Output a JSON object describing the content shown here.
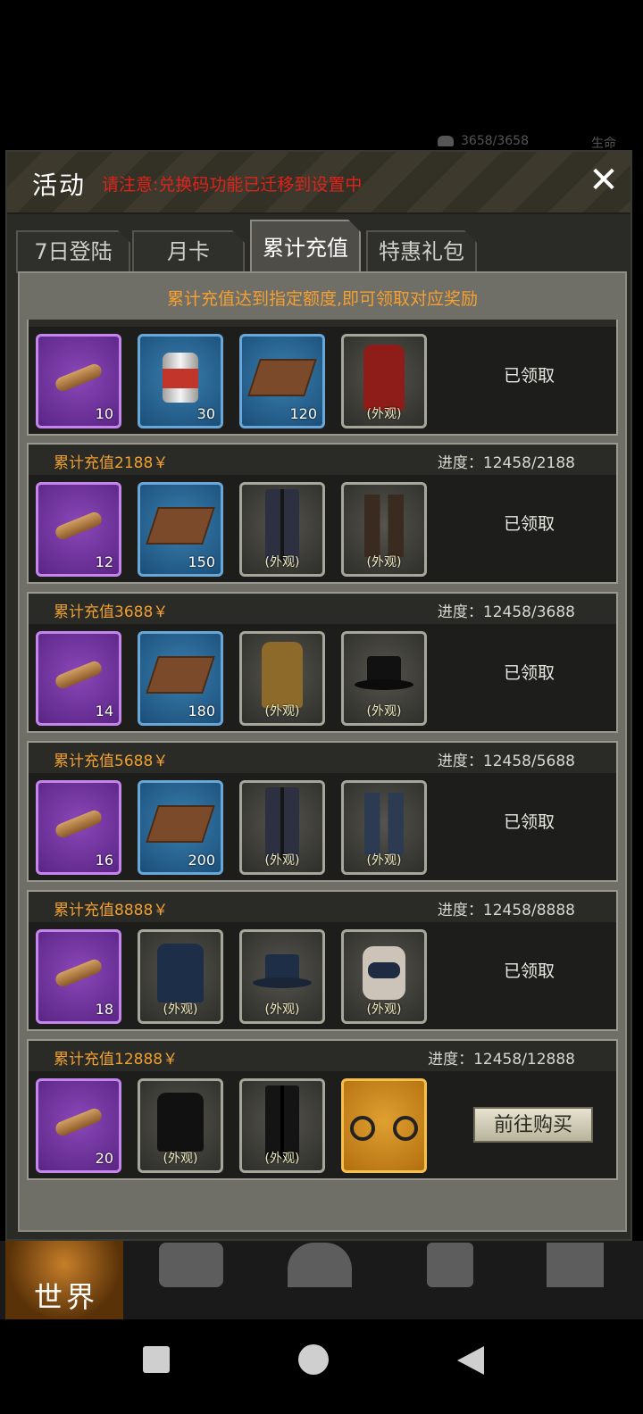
{
  "status": {
    "hp_text": "3658/3658",
    "life_label": "生命"
  },
  "dialog": {
    "title": "活动",
    "notice": "请注意:兑换码功能已迁移到设置中",
    "close_symbol": "✕"
  },
  "tabs": [
    {
      "label": "7日登陆",
      "active": false
    },
    {
      "label": "月卡",
      "active": false
    },
    {
      "label": "累计充值",
      "active": true
    },
    {
      "label": "特惠礼包",
      "active": false
    }
  ],
  "panel_hint": "累计充值达到指定额度,即可领取对应奖励",
  "rows": [
    {
      "title": "",
      "progress": "",
      "status": "已领取",
      "button": "",
      "items": [
        {
          "kind": "cigar",
          "rarity": "purple",
          "qty": "10",
          "tag": ""
        },
        {
          "kind": "can",
          "rarity": "blue",
          "qty": "30",
          "tag": ""
        },
        {
          "kind": "book",
          "rarity": "blue",
          "qty": "120",
          "tag": ""
        },
        {
          "kind": "coat-red",
          "rarity": "gray",
          "qty": "",
          "tag": "(外观)"
        }
      ]
    },
    {
      "title": "累计充值2188￥",
      "progress": "进度：12458/2188",
      "status": "已领取",
      "button": "",
      "items": [
        {
          "kind": "cigar",
          "rarity": "purple",
          "qty": "12",
          "tag": ""
        },
        {
          "kind": "book",
          "rarity": "blue",
          "qty": "150",
          "tag": ""
        },
        {
          "kind": "pants",
          "rarity": "gray",
          "qty": "",
          "tag": "(外观)"
        },
        {
          "kind": "boots",
          "rarity": "gray",
          "qty": "",
          "tag": "(外观)"
        }
      ]
    },
    {
      "title": "累计充值3688￥",
      "progress": "进度：12458/3688",
      "status": "已领取",
      "button": "",
      "items": [
        {
          "kind": "cigar",
          "rarity": "purple",
          "qty": "14",
          "tag": ""
        },
        {
          "kind": "book",
          "rarity": "blue",
          "qty": "180",
          "tag": ""
        },
        {
          "kind": "coat-brown",
          "rarity": "gray",
          "qty": "",
          "tag": "(外观)"
        },
        {
          "kind": "hat-black",
          "rarity": "gray",
          "qty": "",
          "tag": "(外观)"
        }
      ]
    },
    {
      "title": "累计充值5688￥",
      "progress": "进度：12458/5688",
      "status": "已领取",
      "button": "",
      "items": [
        {
          "kind": "cigar",
          "rarity": "purple",
          "qty": "16",
          "tag": ""
        },
        {
          "kind": "book",
          "rarity": "blue",
          "qty": "200",
          "tag": ""
        },
        {
          "kind": "pants",
          "rarity": "gray",
          "qty": "",
          "tag": "(外观)"
        },
        {
          "kind": "boots-blue",
          "rarity": "gray",
          "qty": "",
          "tag": "(外观)"
        }
      ]
    },
    {
      "title": "累计充值8888￥",
      "progress": "进度：12458/8888",
      "status": "已领取",
      "button": "",
      "items": [
        {
          "kind": "cigar",
          "rarity": "purple",
          "qty": "18",
          "tag": ""
        },
        {
          "kind": "jacket",
          "rarity": "gray",
          "qty": "",
          "tag": "(外观)"
        },
        {
          "kind": "hat",
          "rarity": "gray",
          "qty": "",
          "tag": "(外观)"
        },
        {
          "kind": "top",
          "rarity": "gray",
          "qty": "",
          "tag": "(外观)"
        }
      ]
    },
    {
      "title": "累计充值12888￥",
      "progress": "进度：12458/12888",
      "status": "",
      "button": "前往购买",
      "items": [
        {
          "kind": "cigar",
          "rarity": "purple",
          "qty": "20",
          "tag": ""
        },
        {
          "kind": "jacket-black",
          "rarity": "gray",
          "qty": "",
          "tag": "(外观)"
        },
        {
          "kind": "pants-black",
          "rarity": "gray",
          "qty": "",
          "tag": "(外观)"
        },
        {
          "kind": "motorcycle",
          "rarity": "gold",
          "qty": "",
          "tag": ""
        }
      ]
    }
  ],
  "bottom_nav": {
    "world_label": "世界"
  }
}
